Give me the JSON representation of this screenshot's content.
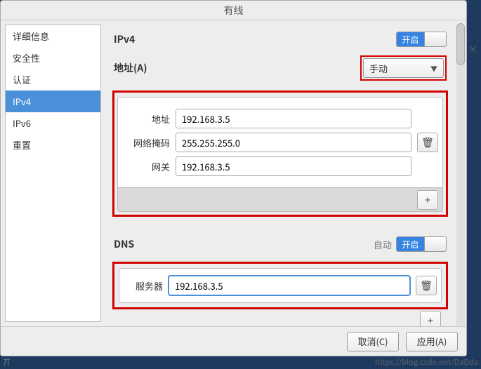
{
  "window": {
    "title": "有线"
  },
  "sidebar": {
    "items": [
      {
        "label": "详细信息",
        "active": false
      },
      {
        "label": "安全性",
        "active": false
      },
      {
        "label": "认证",
        "active": false
      },
      {
        "label": "IPv4",
        "active": true
      },
      {
        "label": "IPv6",
        "active": false
      },
      {
        "label": "重置",
        "active": false
      }
    ]
  },
  "panel": {
    "ipv4_label": "IPv4",
    "ipv4_toggle_on": "开启",
    "address_section_label": "地址(A)",
    "address_method_selected": "手动",
    "rows": {
      "address_label": "地址",
      "address_value": "192.168.3.5",
      "netmask_label": "网络掩码",
      "netmask_value": "255.255.255.0",
      "gateway_label": "网关",
      "gateway_value": "192.168.3.5"
    },
    "dns_label": "DNS",
    "dns_auto_label": "自动",
    "dns_toggle_on": "开启",
    "dns_server_label": "服务器",
    "dns_server_value": "192.168.3.5"
  },
  "footer": {
    "cancel": "取消(C)",
    "apply": "应用(A)"
  },
  "icons": {
    "trash": "🗑",
    "plus": "+",
    "chevron": "▼",
    "close": "×"
  },
  "watermark": "https://blog.csdn.net/DaDda",
  "fragment": "丌"
}
